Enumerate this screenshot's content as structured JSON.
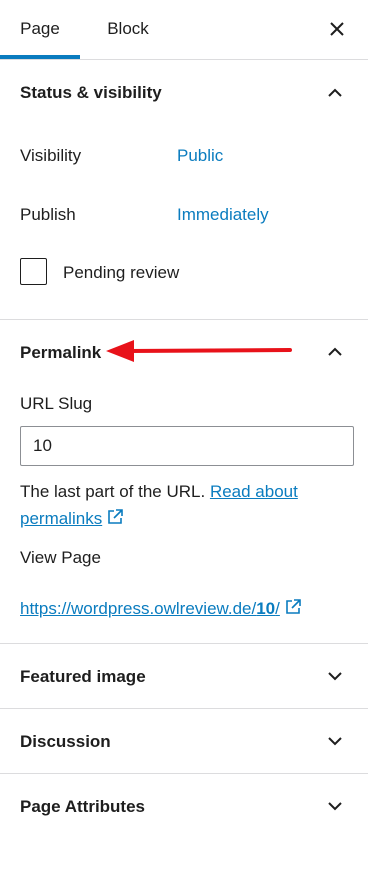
{
  "tabs": {
    "page_label": "Page",
    "block_label": "Block",
    "active": "Page",
    "accent_color": "#0a7cbf"
  },
  "status_visibility": {
    "title": "Status & visibility",
    "visibility_label": "Visibility",
    "visibility_value": "Public",
    "publish_label": "Publish",
    "publish_value": "Immediately",
    "pending_review_label": "Pending review",
    "pending_review_checked": false
  },
  "permalink": {
    "title": "Permalink",
    "url_slug_label": "URL Slug",
    "url_slug_value": "10",
    "help_text": "The last part of the URL.",
    "help_link": "Read about permalinks",
    "view_page_label": "View Page",
    "view_page_url_base": "https://wordpress.owlreview.de/",
    "view_page_url_slug": "10",
    "view_page_url_tail": "/",
    "annotation_arrow_color": "#e8121a"
  },
  "featured_image": {
    "title": "Featured image"
  },
  "discussion": {
    "title": "Discussion"
  },
  "page_attributes": {
    "title": "Page Attributes"
  },
  "icons": {
    "close": "close-icon",
    "collapse": "chevron-up-icon",
    "expand": "chevron-down-icon",
    "external": "external-link-icon"
  }
}
